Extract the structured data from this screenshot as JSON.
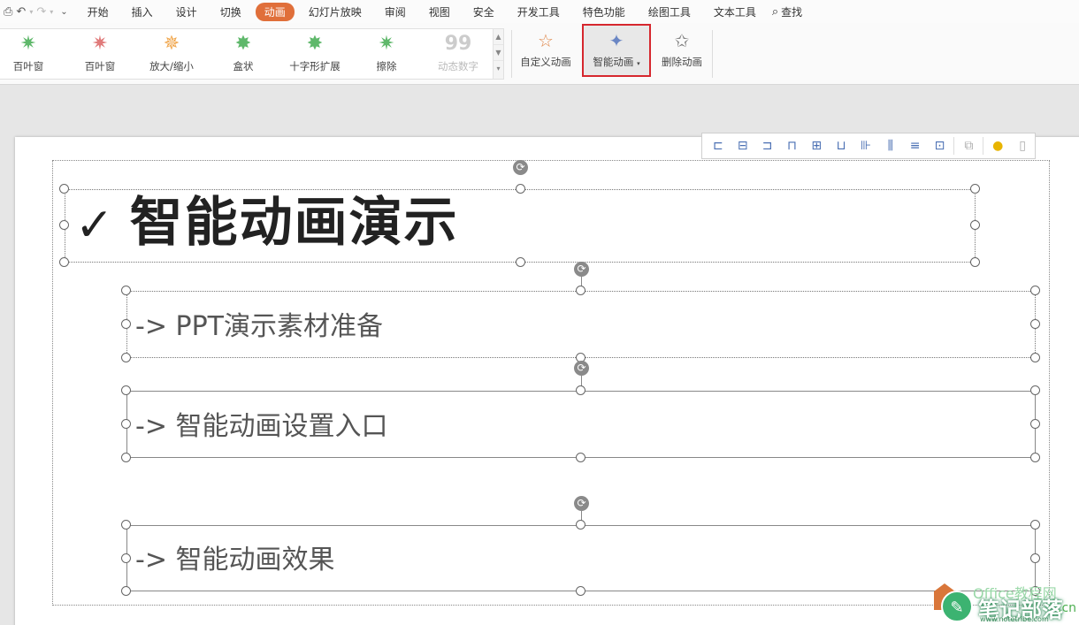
{
  "quick_access": {
    "icons": [
      "print-preview-icon",
      "undo-icon",
      "redo-icon",
      "customize-icon"
    ]
  },
  "menu": {
    "items": [
      "开始",
      "插入",
      "设计",
      "切换",
      "动画",
      "幻灯片放映",
      "审阅",
      "视图",
      "安全",
      "开发工具",
      "特色功能",
      "绘图工具",
      "文本工具"
    ],
    "active": "动画",
    "search_label": "查找"
  },
  "gallery": {
    "items": [
      {
        "label": "百叶窗",
        "color": "#5fb86b"
      },
      {
        "label": "百叶窗",
        "color": "#e07b7b"
      },
      {
        "label": "放大/缩小",
        "color": "#f0a54a"
      },
      {
        "label": "盒状",
        "color": "#5fb86b"
      },
      {
        "label": "十字形扩展",
        "color": "#5fb86b"
      },
      {
        "label": "擦除",
        "color": "#5fb86b"
      },
      {
        "label": "动态数字",
        "color": "#cccccc",
        "digits": "99"
      }
    ]
  },
  "ribbon": {
    "custom_animation": "自定义动画",
    "smart_animation": "智能动画",
    "delete_animation": "删除动画"
  },
  "slide": {
    "title": "智能动画演示",
    "check_mark": "✓",
    "items": [
      "-> PPT演示素材准备",
      "-> 智能动画设置入口",
      "-> 智能动画效果"
    ]
  },
  "watermark": {
    "text": "笔记部落",
    "office_text": "Office教程网",
    "url": "www.notetribe.com",
    "cn": ".cn"
  },
  "colors": {
    "accent": "#e06f3a",
    "highlight_border": "#d6272e"
  }
}
